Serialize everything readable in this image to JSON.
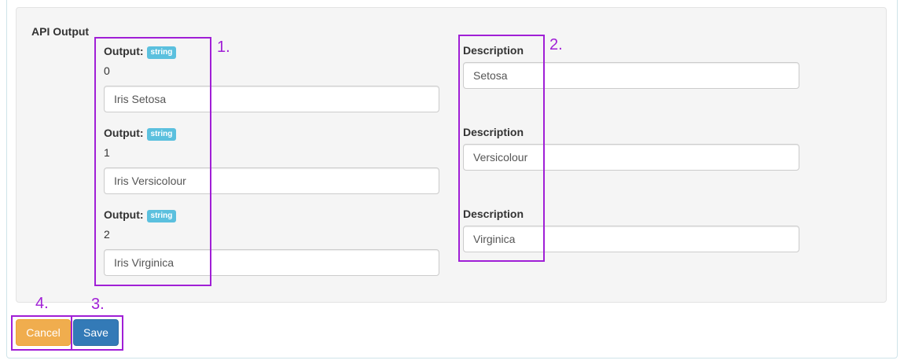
{
  "section_title": "API Output",
  "outputs": [
    {
      "label": "Output:",
      "badge": "string",
      "index": "0",
      "value": "Iris Setosa"
    },
    {
      "label": "Output:",
      "badge": "string",
      "index": "1",
      "value": "Iris Versicolour"
    },
    {
      "label": "Output:",
      "badge": "string",
      "index": "2",
      "value": "Iris Virginica"
    }
  ],
  "descriptions": [
    {
      "label": "Description",
      "value": "Setosa"
    },
    {
      "label": "Description",
      "value": "Versicolour"
    },
    {
      "label": "Description",
      "value": "Virginica"
    }
  ],
  "buttons": {
    "cancel": "Cancel",
    "save": "Save"
  },
  "annotations": [
    "1.",
    "2.",
    "3.",
    "4."
  ],
  "colors": {
    "annotation": "#a01fd6",
    "badge": "#5bc0de",
    "cancel": "#f0ad4e",
    "save": "#337ab7"
  }
}
